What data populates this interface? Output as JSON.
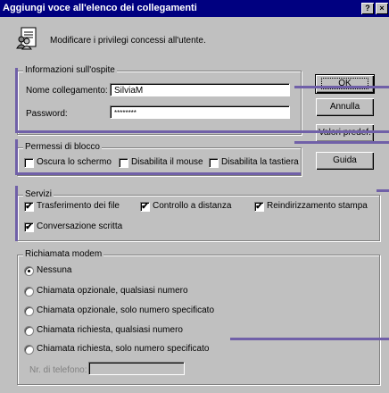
{
  "window": {
    "title": "Aggiungi voce all'elenco dei collegamenti",
    "help_btn": "?",
    "close_btn": "×"
  },
  "header": {
    "description": "Modificare i privilegi concessi all'utente."
  },
  "guest_info": {
    "legend": "Informazioni sull'ospite",
    "name_label": "Nome collegamento:",
    "name_value": "SilviaM",
    "password_label": "Password:",
    "password_value": "********"
  },
  "buttons": {
    "ok": "OK",
    "cancel": "Annulla",
    "defaults": "Valori predef.",
    "help": "Guida"
  },
  "block_permissions": {
    "legend": "Permessi di blocco",
    "items": [
      {
        "label": "Oscura lo schermo",
        "checked": false
      },
      {
        "label": "Disabilita il mouse",
        "checked": false
      },
      {
        "label": "Disabilita la tastiera",
        "checked": false
      }
    ]
  },
  "services": {
    "legend": "Servizi",
    "items": [
      {
        "label": "Trasferimento dei file",
        "checked": true
      },
      {
        "label": "Controllo a distanza",
        "checked": true
      },
      {
        "label": "Reindirizzamento stampa",
        "checked": true
      },
      {
        "label": "Conversazione scritta",
        "checked": true
      }
    ]
  },
  "modem_callback": {
    "legend": "Richiamata modem",
    "options": [
      {
        "label": "Nessuna",
        "selected": true
      },
      {
        "label": "Chiamata opzionale, qualsiasi numero",
        "selected": false
      },
      {
        "label": "Chiamata opzionale, solo numero specificato",
        "selected": false
      },
      {
        "label": "Chiamata richiesta, qualsiasi numero",
        "selected": false
      },
      {
        "label": "Chiamata richiesta, solo numero specificato",
        "selected": false
      }
    ],
    "phone_label": "Nr. di telefono:",
    "phone_value": ""
  },
  "check_mark": "✔",
  "colors": {
    "titlebar": "#000080",
    "face": "#c0c0c0",
    "callout": "#7060a8"
  }
}
